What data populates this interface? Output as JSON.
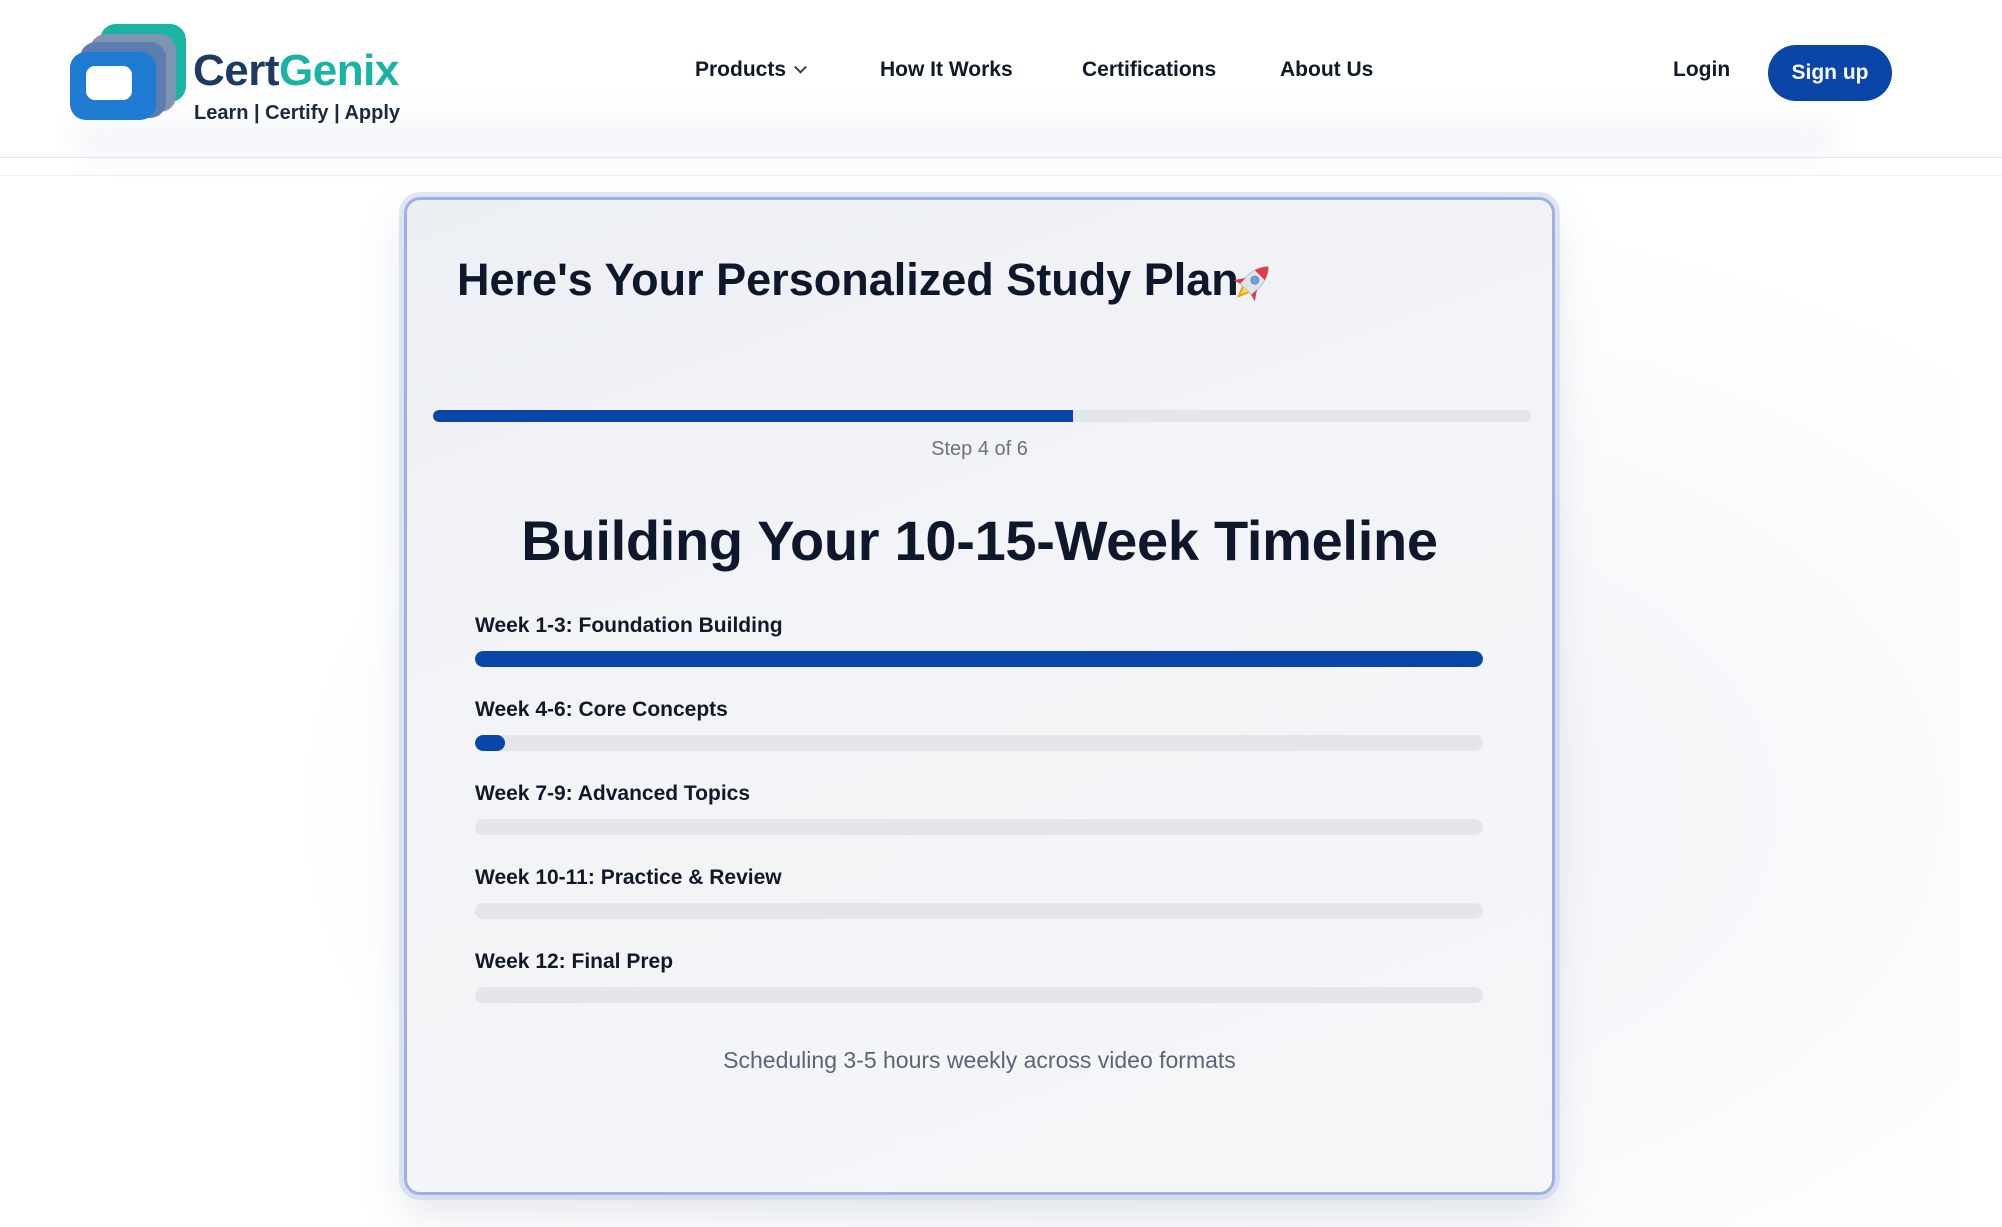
{
  "brand": {
    "name_part1": "Cert",
    "name_part2": "Genix",
    "tagline": "Learn | Certify | Apply",
    "colors": {
      "navy": "#1f3a5f",
      "teal": "#17b3a3",
      "accent": "#0a46a8"
    }
  },
  "nav": {
    "products": "Products",
    "how_it_works": "How It Works",
    "certifications": "Certifications",
    "about_us": "About Us"
  },
  "auth": {
    "login": "Login",
    "signup": "Sign up"
  },
  "plan": {
    "title": "Here's Your Personalized Study Plan",
    "title_icon": "rocket-icon",
    "step_label": "Step 4 of 6",
    "step_current": 4,
    "step_total": 6,
    "step_progress": 0.583,
    "section_title": "Building Your 10-15-Week Timeline",
    "phases": [
      {
        "label": "Week 1-3: Foundation Building",
        "progress": 1.0
      },
      {
        "label": "Week 4-6: Core Concepts",
        "progress": 0.03
      },
      {
        "label": "Week 7-9: Advanced Topics",
        "progress": 0
      },
      {
        "label": "Week 10-11: Practice & Review",
        "progress": 0
      },
      {
        "label": "Week 12: Final Prep",
        "progress": 0
      }
    ],
    "note": "Scheduling 3-5 hours weekly across video formats"
  }
}
